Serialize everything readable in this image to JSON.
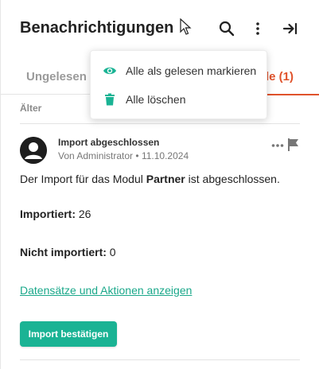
{
  "header": {
    "title": "Benachrichtigungen"
  },
  "tabs": [
    {
      "label": "Ungelesen (6)"
    },
    {
      "label": "Alle (1)"
    }
  ],
  "menu": {
    "items": [
      {
        "label": "Alle als gelesen markieren",
        "icon": "eye-icon",
        "color": "#1ab394"
      },
      {
        "label": "Alle löschen",
        "icon": "trash-icon",
        "color": "#1ab394"
      }
    ]
  },
  "section": {
    "label": "Älter"
  },
  "notification": {
    "title": "Import abgeschlossen",
    "author": "Von Administrator",
    "separator": "•",
    "date": "11.10.2024",
    "message_prefix": "Der Import für das Modul ",
    "module": "Partner",
    "message_suffix": " ist abgeschlossen.",
    "imported_label": "Importiert:",
    "imported_value": "26",
    "not_imported_label": "Nicht importiert:",
    "not_imported_value": "0",
    "link_label": "Datensätze und Aktionen anzeigen",
    "button_label": "Import bestätigen"
  },
  "colors": {
    "accent": "#1ab394",
    "active_tab": "#e0522b"
  }
}
